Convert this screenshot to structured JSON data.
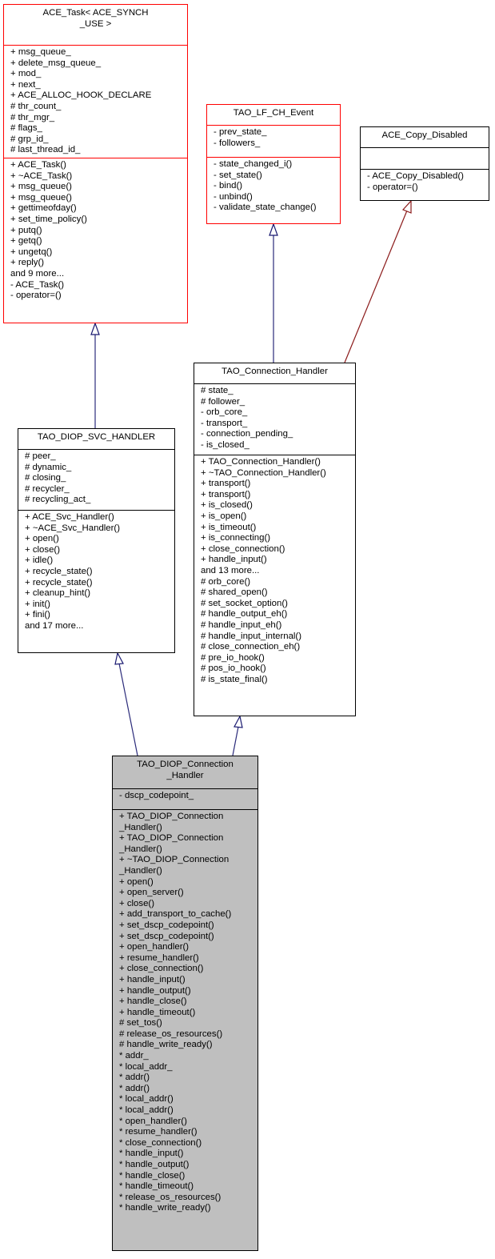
{
  "diagram": {
    "classes": {
      "ace_task": {
        "title_lines": [
          "ACE_Task< ACE_SYNCH",
          "_USE >"
        ],
        "attributes": [
          "+ msg_queue_",
          "+ delete_msg_queue_",
          "+ mod_",
          "+ next_",
          "+ ACE_ALLOC_HOOK_DECLARE",
          "# thr_count_",
          "# thr_mgr_",
          "# flags_",
          "# grp_id_",
          "# last_thread_id_"
        ],
        "methods": [
          "+ ACE_Task()",
          "+ ~ACE_Task()",
          "+ msg_queue()",
          "+ msg_queue()",
          "+ gettimeofday()",
          "+ set_time_policy()",
          "+ putq()",
          "+ getq()",
          "+ ungetq()",
          "+ reply()",
          "and 9 more...",
          "- ACE_Task()",
          "- operator=()"
        ]
      },
      "tao_lf_ch_event": {
        "title_lines": [
          "TAO_LF_CH_Event"
        ],
        "attributes": [
          "- prev_state_",
          "- followers_"
        ],
        "methods": [
          "- state_changed_i()",
          "- set_state()",
          "- bind()",
          "- unbind()",
          "- validate_state_change()"
        ]
      },
      "ace_copy_disabled": {
        "title_lines": [
          "ACE_Copy_Disabled"
        ],
        "attributes": [],
        "methods": [
          "- ACE_Copy_Disabled()",
          "- operator=()"
        ]
      },
      "tao_connection_handler": {
        "title_lines": [
          "TAO_Connection_Handler"
        ],
        "attributes": [
          "# state_",
          "# follower_",
          "- orb_core_",
          "- transport_",
          "- connection_pending_",
          "- is_closed_"
        ],
        "methods": [
          "+ TAO_Connection_Handler()",
          "+ ~TAO_Connection_Handler()",
          "+ transport()",
          "+ transport()",
          "+ is_closed()",
          "+ is_open()",
          "+ is_timeout()",
          "+ is_connecting()",
          "+ close_connection()",
          "+ handle_input()",
          "and 13 more...",
          "# orb_core()",
          "# shared_open()",
          "# set_socket_option()",
          "# handle_output_eh()",
          "# handle_input_eh()",
          "# handle_input_internal()",
          "# close_connection_eh()",
          "# pre_io_hook()",
          "# pos_io_hook()",
          "# is_state_final()"
        ]
      },
      "tao_diop_svc_handler": {
        "title_lines": [
          "TAO_DIOP_SVC_HANDLER"
        ],
        "attributes": [
          "# peer_",
          "# dynamic_",
          "# closing_",
          "# recycler_",
          "# recycling_act_"
        ],
        "methods": [
          "+ ACE_Svc_Handler()",
          "+ ~ACE_Svc_Handler()",
          "+ open()",
          "+ close()",
          "+ idle()",
          "+ recycle_state()",
          "+ recycle_state()",
          "+ cleanup_hint()",
          "+ init()",
          "+ fini()",
          "and 17 more..."
        ]
      },
      "tao_diop_connection_handler": {
        "title_lines": [
          "TAO_DIOP_Connection",
          "_Handler"
        ],
        "attributes": [
          "- dscp_codepoint_"
        ],
        "methods": [
          "+ TAO_DIOP_Connection",
          "_Handler()",
          "+ TAO_DIOP_Connection",
          "_Handler()",
          "+ ~TAO_DIOP_Connection",
          "_Handler()",
          "+ open()",
          "+ open_server()",
          "+ close()",
          "+ add_transport_to_cache()",
          "+ set_dscp_codepoint()",
          "+ set_dscp_codepoint()",
          "+ open_handler()",
          "+ resume_handler()",
          "+ close_connection()",
          "+ handle_input()",
          "+ handle_output()",
          "+ handle_close()",
          "+ handle_timeout()",
          "# set_tos()",
          "# release_os_resources()",
          "# handle_write_ready()",
          "* addr_",
          "* local_addr_",
          "* addr()",
          "* addr()",
          "* local_addr()",
          "* local_addr()",
          "* open_handler()",
          "* resume_handler()",
          "* close_connection()",
          "* handle_input()",
          "* handle_output()",
          "* handle_close()",
          "* handle_timeout()",
          "* release_os_resources()",
          "* handle_write_ready()"
        ]
      }
    },
    "edges": [
      {
        "from": "tao_diop_svc_handler",
        "to": "ace_task",
        "kind": "public-inheritance",
        "color": "#191970"
      },
      {
        "from": "tao_connection_handler",
        "to": "tao_lf_ch_event",
        "kind": "public-inheritance",
        "color": "#191970"
      },
      {
        "from": "tao_connection_handler",
        "to": "ace_copy_disabled",
        "kind": "private-inheritance",
        "color": "#8b1a1a"
      },
      {
        "from": "tao_diop_connection_handler",
        "to": "tao_diop_svc_handler",
        "kind": "public-inheritance",
        "color": "#191970"
      },
      {
        "from": "tao_diop_connection_handler",
        "to": "tao_connection_handler",
        "kind": "public-inheritance",
        "color": "#191970"
      }
    ]
  }
}
